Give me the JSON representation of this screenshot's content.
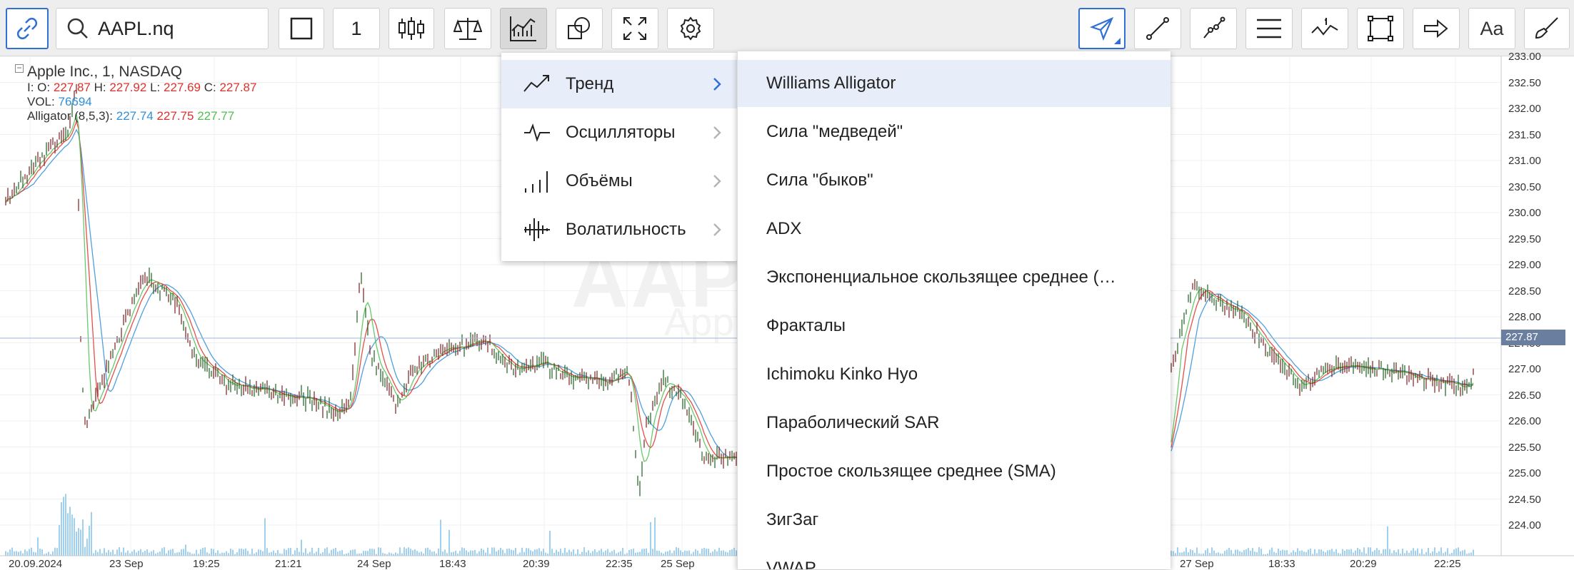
{
  "toolbar": {
    "symbol": "AAPL.nq",
    "interval": "1",
    "font_button": "Aa",
    "icons": [
      "link-icon",
      "search-icon",
      "square-icon",
      "candles-icon",
      "compare-icon",
      "indicators-icon",
      "shapes-icon",
      "fullscreen-icon",
      "gear-icon",
      "cursor-arrow-icon",
      "line-icon",
      "polyline-icon",
      "channel-icon",
      "annotation-icon",
      "rectangle-icon",
      "arrow-right-icon",
      "brush-icon"
    ]
  },
  "legend": {
    "title": "Apple Inc.,  1,  NASDAQ",
    "ohlc_prefix_o": "I: O:",
    "o": "227.87",
    "h_label": "H:",
    "h": "227.92",
    "l_label": "L:",
    "l": "227.69",
    "c_label": "C:",
    "c": "227.87",
    "vol_label": "VOL:",
    "vol": "76694",
    "alligator_label": "Alligator (8,5,3):",
    "alligator_jaw": "227.74",
    "alligator_teeth": "227.75",
    "alligator_lips": "227.77"
  },
  "watermark": {
    "symbol": "AAPL",
    "name": "Apple Inc."
  },
  "price_axis": [
    "233.00",
    "232.50",
    "232.00",
    "231.50",
    "231.00",
    "230.50",
    "230.00",
    "229.50",
    "229.00",
    "228.50",
    "228.00",
    "227.50",
    "227.00",
    "226.50",
    "226.00",
    "225.50",
    "225.00",
    "224.50",
    "224.00"
  ],
  "current_price": "227.87",
  "time_axis": [
    {
      "label": "20.09.2024"
    },
    {
      "label": "23 Sep"
    },
    {
      "label": "19:25"
    },
    {
      "label": "21:21"
    },
    {
      "label": "24 Sep"
    },
    {
      "label": "18:43"
    },
    {
      "label": "20:39"
    },
    {
      "label": "22:35"
    },
    {
      "label": "25 Sep"
    },
    {
      "label": "27 Sep"
    },
    {
      "label": "18:33"
    },
    {
      "label": "20:29"
    },
    {
      "label": "22:25"
    }
  ],
  "indicator_menu": {
    "categories": [
      {
        "label": "Тренд",
        "icon": "trend-icon",
        "selected": true
      },
      {
        "label": "Осцилляторы",
        "icon": "oscillator-icon",
        "selected": false
      },
      {
        "label": "Объёмы",
        "icon": "volume-icon",
        "selected": false
      },
      {
        "label": "Волатильность",
        "icon": "volatility-icon",
        "selected": false
      }
    ],
    "trend_items": [
      {
        "label": "Williams Alligator",
        "selected": true
      },
      {
        "label": "Сила \"медведей\"",
        "selected": false
      },
      {
        "label": "Сила \"быков\"",
        "selected": false
      },
      {
        "label": "ADX",
        "selected": false
      },
      {
        "label": "Экспоненциальное скользящее среднее (…",
        "selected": false
      },
      {
        "label": "Фракталы",
        "selected": false
      },
      {
        "label": "Ichimoku Kinko Hyo",
        "selected": false
      },
      {
        "label": "Параболический SAR",
        "selected": false
      },
      {
        "label": "Простое скользящее среднее (SMA)",
        "selected": false
      },
      {
        "label": "ЗигЗаг",
        "selected": false
      },
      {
        "label": "VWAP",
        "selected": false
      }
    ]
  },
  "colors": {
    "accent": "#2f6fd6",
    "bear": "#e0302b",
    "alligator_jaw": "#2f8fd8",
    "alligator_teeth": "#e0302b",
    "alligator_lips": "#4fbf4f",
    "volume": "#9fd0f0"
  }
}
